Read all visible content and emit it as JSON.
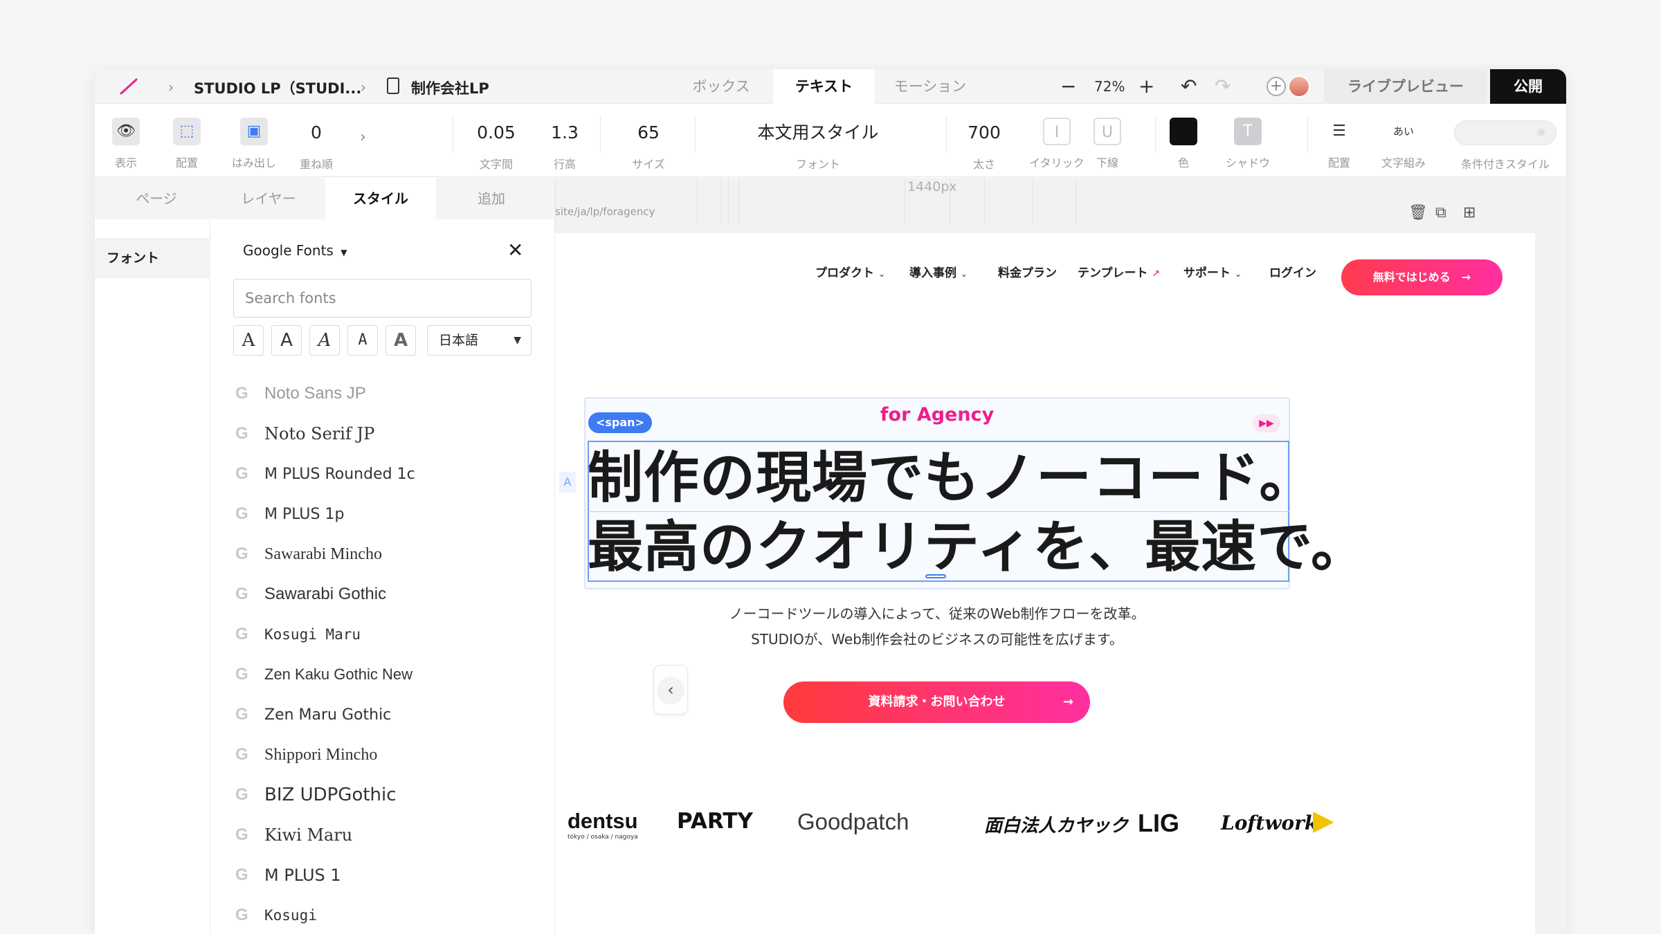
{
  "topbar": {
    "project_name": "STUDIO LP（STUDI...",
    "page_name": "制作会社LP",
    "mode_tabs": [
      "ボックス",
      "テキスト",
      "モーション"
    ],
    "zoom": "72%",
    "zoom_minus": "−",
    "zoom_plus": "+",
    "live_preview_label": "ライブプレビュー",
    "publish_label": "公開"
  },
  "toolbar": {
    "visibility_label": "表示",
    "placement_label": "配置",
    "overflow_label": "はみ出し",
    "order_value": "0",
    "order_label": "重ね順",
    "letter_spacing_value": "0.05",
    "letter_spacing_label": "文字間",
    "line_height_value": "1.3",
    "line_height_label": "行高",
    "size_value": "65",
    "size_label": "サイズ",
    "font_value": "本文用スタイル",
    "font_label": "フォント",
    "weight_value": "700",
    "weight_label": "太さ",
    "italic_label": "イタリック",
    "underline_label": "下線",
    "color_label": "色",
    "shadow_label": "シャドウ",
    "align_label": "配置",
    "typesetting_label": "文字組み",
    "typesetting_icon_text": "あい",
    "conditional_label": "条件付きスタイル",
    "text_color": "#111111"
  },
  "panel": {
    "tabs": [
      "ページ",
      "レイヤー",
      "スタイル",
      "追加"
    ],
    "active_tab": "スタイル",
    "category": "フォント",
    "source_dropdown": "Google Fonts",
    "search_placeholder": "Search fonts",
    "style_buttons": [
      "A",
      "A",
      "A",
      "A",
      "A"
    ],
    "language": "日本語",
    "fonts": [
      "Noto Sans JP",
      "Noto Serif JP",
      "M PLUS Rounded 1c",
      "M PLUS 1p",
      "Sawarabi Mincho",
      "Sawarabi Gothic",
      "Kosugi Maru",
      "Zen Kaku Gothic New",
      "Zen Maru Gothic",
      "Shippori Mincho",
      "BIZ UDPGothic",
      "Kiwi Maru",
      "M PLUS 1",
      "Kosugi"
    ]
  },
  "canvas": {
    "ruler_label": "1440px",
    "url": "site/ja/lp/foragency"
  },
  "site": {
    "nav": [
      "プロダクト",
      "導入事例",
      "料金プラン",
      "テンプレート",
      "サポート",
      "ログイン"
    ],
    "nav_cta": "無料ではじめる　→",
    "span_badge": "<span>",
    "eyebrow": "for Agency",
    "headline_line1": "制作の現場でもノーコード。",
    "headline_line2": "最高のクオリティを、最速で。",
    "subtext_line1": "ノーコードツールの導入によって、従来のWeb制作フローを改革。",
    "subtext_line2": "STUDIOが、Web制作会社のビジネスの可能性を広げます。",
    "main_cta": "資料請求・お問い合わせ",
    "logos": [
      "dentsu",
      "PARTY",
      "Goodpatch",
      "面白法人カヤック",
      "LIG",
      "Loftwork"
    ],
    "dentsu_sub": "tokyo / osaka / nagoya",
    "accent_color": "#ff2f6e"
  }
}
